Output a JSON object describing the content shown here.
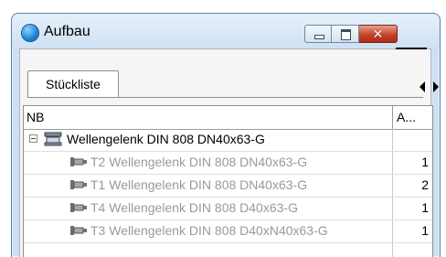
{
  "window": {
    "title": "Aufbau",
    "close_glyph": "✕"
  },
  "tabs": [
    {
      "label": "Stückliste"
    }
  ],
  "table": {
    "columns": [
      "NB",
      "A..."
    ],
    "rows": [
      {
        "label": "Wellengelenk DIN 808 DN40x63-G",
        "qty": "",
        "level": 0,
        "icon": "assembly-icon",
        "expanded": true
      },
      {
        "label": "T2 Wellengelenk DIN 808 DN40x63-G",
        "qty": "1",
        "level": 1,
        "icon": "part-icon"
      },
      {
        "label": "T1 Wellengelenk DIN 808 DN40x63-G",
        "qty": "2",
        "level": 1,
        "icon": "part-icon"
      },
      {
        "label": "T4 Wellengelenk DIN 808 D40x63-G",
        "qty": "1",
        "level": 1,
        "icon": "part-icon"
      },
      {
        "label": "T3 Wellengelenk DIN 808 D40xN40x63-G",
        "qty": "1",
        "level": 1,
        "icon": "part-icon"
      }
    ]
  },
  "colors": {
    "titlebar": "#cfe1f3",
    "close_button": "#c8432a",
    "child_text": "#9a9a9a"
  }
}
